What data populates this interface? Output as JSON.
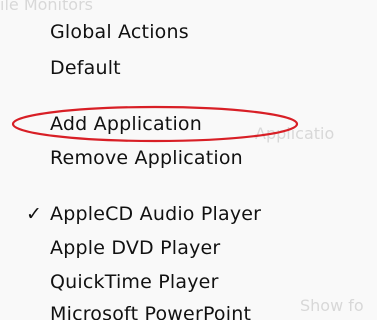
{
  "menu": {
    "ghost_texts": [
      "ile  Monitors",
      "Applicatio",
      "Show fo"
    ],
    "items": [
      {
        "label": "Global Actions"
      },
      {
        "label": "Default"
      },
      {
        "label": "Add Application"
      },
      {
        "label": "Remove Application"
      },
      {
        "label": "AppleCD Audio Player",
        "checked": true
      },
      {
        "label": "Apple DVD Player"
      },
      {
        "label": "QuickTime Player"
      },
      {
        "label": "Microsoft PowerPoint"
      }
    ],
    "check_glyph": "✓",
    "highlight_color": "#d81f26"
  }
}
